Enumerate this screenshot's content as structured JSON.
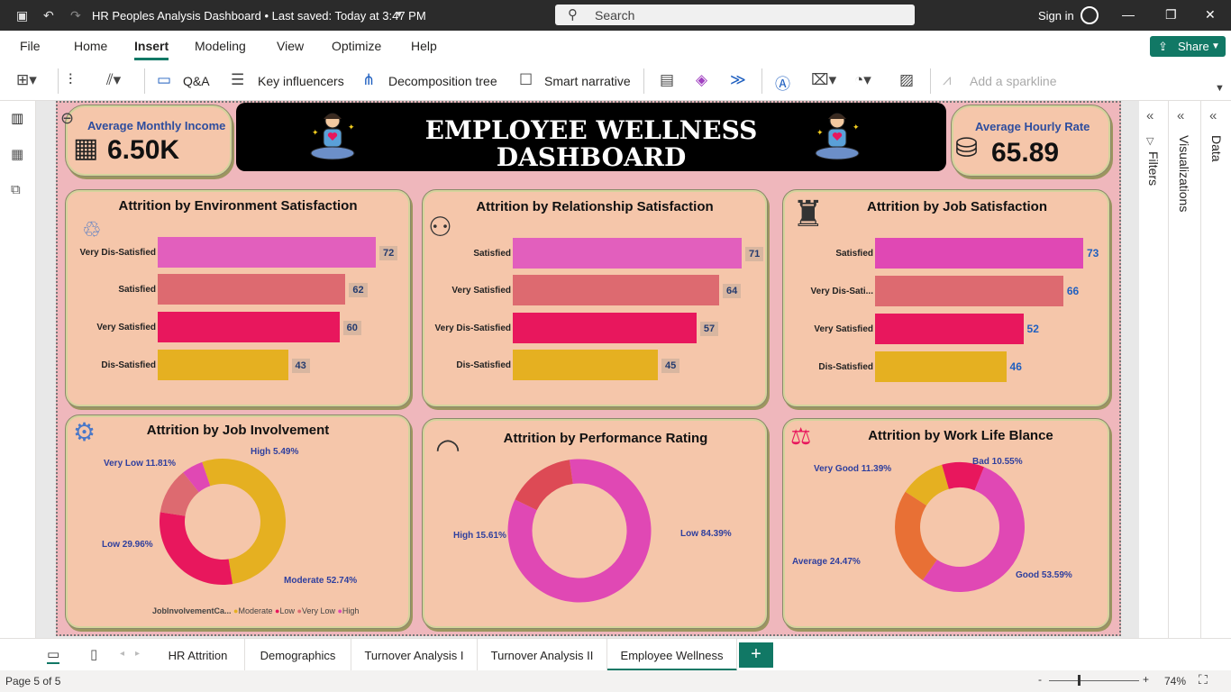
{
  "window": {
    "title": "HR Peoples Analysis Dashboard • Last saved: Today at 3:47 PM",
    "search_placeholder": "Search",
    "signin": "Sign in"
  },
  "menu": {
    "file": "File",
    "home": "Home",
    "insert": "Insert",
    "modeling": "Modeling",
    "view": "View",
    "optimize": "Optimize",
    "help": "Help",
    "share": "Share"
  },
  "ribbon": {
    "qa": "Q&A",
    "key_influencers": "Key influencers",
    "decomposition_tree": "Decomposition tree",
    "smart_narrative": "Smart narrative",
    "add_sparkline": "Add a sparkline"
  },
  "panes": {
    "filters": "Filters",
    "visualizations": "Visualizations",
    "data": "Data"
  },
  "kpis": {
    "avg_monthly_income_label": "Average Monthly Income",
    "avg_monthly_income_value": "6.50K",
    "avg_hourly_rate_label": "Average Hourly Rate",
    "avg_hourly_rate_value": "65.89"
  },
  "banner": {
    "line1": "EMPLOYEE WELLNESS",
    "line2": "DASHBOARD"
  },
  "chart_data": [
    {
      "type": "bar",
      "title": "Attrition by Environment Satisfaction",
      "categories": [
        "Very Dis-Satisfied",
        "Satisfied",
        "Very Satisfied",
        "Dis-Satisfied"
      ],
      "values": [
        72,
        62,
        60,
        43
      ],
      "colors": [
        "#e25fbd",
        "#dd6a70",
        "#e8175d",
        "#e5b021"
      ]
    },
    {
      "type": "bar",
      "title": "Attrition by Relationship Satisfaction",
      "categories": [
        "Satisfied",
        "Very Satisfied",
        "Very Dis-Satisfied",
        "Dis-Satisfied"
      ],
      "values": [
        71,
        64,
        57,
        45
      ],
      "colors": [
        "#e25fbd",
        "#dd6a70",
        "#e8175d",
        "#e5b021"
      ]
    },
    {
      "type": "bar",
      "title": "Attrition by Job Satisfaction",
      "categories": [
        "Satisfied",
        "Very Dis-Sati...",
        "Very Satisfied",
        "Dis-Satisfied"
      ],
      "values": [
        73,
        66,
        52,
        46
      ],
      "colors": [
        "#e048b4",
        "#dd6a70",
        "#e8175d",
        "#e5b021"
      ]
    },
    {
      "type": "pie",
      "title": "Attrition by Job Involvement",
      "labels": [
        "Moderate 52.74%",
        "Low 29.96%",
        "Very Low 11.81%",
        "High 5.49%"
      ],
      "values": [
        52.74,
        29.96,
        11.81,
        5.49
      ],
      "colors": [
        "#e5b021",
        "#e8175d",
        "#dd6a70",
        "#e048b4"
      ],
      "legend_title": "JobInvolvementCa...",
      "legend": [
        "Moderate",
        "Low",
        "Very Low",
        "High"
      ]
    },
    {
      "type": "pie",
      "title": "Attrition by Performance Rating",
      "labels": [
        "Low 84.39%",
        "High 15.61%"
      ],
      "values": [
        84.39,
        15.61
      ],
      "colors": [
        "#e048b4",
        "#dd4a55"
      ]
    },
    {
      "type": "pie",
      "title": "Attrition by Work Life Blance",
      "labels": [
        "Good 53.59%",
        "Average 24.47%",
        "Very Good 11.39%",
        "Bad 10.55%"
      ],
      "values": [
        53.59,
        24.47,
        11.39,
        10.55
      ],
      "colors": [
        "#e048b4",
        "#e87035",
        "#e5b021",
        "#e8175d"
      ]
    }
  ],
  "tabs": [
    "HR Attrition",
    "Demographics",
    "Turnover Analysis I",
    "Turnover Analysis II",
    "Employee Wellness"
  ],
  "status": {
    "page": "Page 5 of 5",
    "zoom": "74%"
  }
}
